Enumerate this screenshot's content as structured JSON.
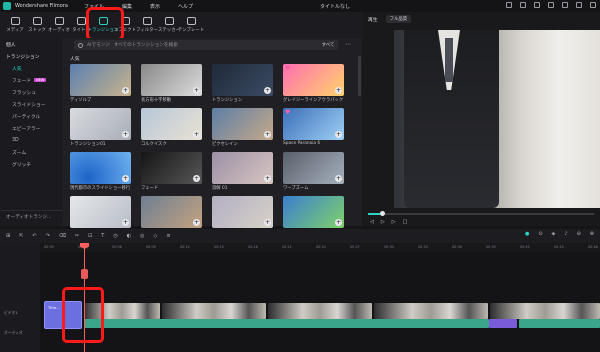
{
  "app": {
    "name": "Wondershare Filmora",
    "project_title": "タイトルなし"
  },
  "menu": [
    "ファイル",
    "編集",
    "表示",
    "ヘルプ"
  ],
  "toolbar": [
    {
      "label": "メディア",
      "icon": "media-icon"
    },
    {
      "label": "ストック",
      "icon": "stock-icon"
    },
    {
      "label": "オーディオ",
      "icon": "audio-icon"
    },
    {
      "label": "タイトル",
      "icon": "title-icon"
    },
    {
      "label": "トランジション",
      "icon": "transition-icon",
      "active": true
    },
    {
      "label": "エフェクト",
      "icon": "effect-icon"
    },
    {
      "label": "フィルター",
      "icon": "filter-icon"
    },
    {
      "label": "ステッカー",
      "icon": "sticker-icon"
    },
    {
      "label": "テンプレート",
      "icon": "template-icon"
    }
  ],
  "sidebar": {
    "items": [
      {
        "label": "個人",
        "type": "head"
      },
      {
        "label": "トランジション",
        "type": "head"
      },
      {
        "label": "人気",
        "type": "selected"
      },
      {
        "label": "フェード",
        "badge": "NEW"
      },
      {
        "label": "フラッシュ"
      },
      {
        "label": "スライドショー"
      },
      {
        "label": "パーティクル"
      },
      {
        "label": "エピーアラー"
      },
      {
        "label": "3D"
      },
      {
        "label": "ズーム"
      },
      {
        "label": "グリッチ"
      }
    ],
    "footer": "オーディオトランジ..."
  },
  "content": {
    "search_placeholder": "すべてのトランジションを検索",
    "search_prefix": "AIでモンジ",
    "filter": "すべて",
    "section": "人気",
    "items": [
      {
        "label": "ディゾルブ",
        "bg": "linear-gradient(135deg,#5b7fb0,#c9b48c)"
      },
      {
        "label": "長方形十字移動",
        "bg": "linear-gradient(135deg,#888,#ddd)"
      },
      {
        "label": "トランジション",
        "bg": "linear-gradient(135deg,#1f2a3a,#3b4b63)"
      },
      {
        "label": "グレイジーラインアウラパック トラン...",
        "bg": "linear-gradient(135deg,#ff6fb1,#ffd36b)",
        "heart": true
      },
      {
        "label": "トランジション01",
        "bg": "linear-gradient(135deg,#d8dbe0,#a9aeb6)"
      },
      {
        "label": "コルクイスク",
        "bg": "linear-gradient(135deg,#b7c6d8,#e9e2d3)"
      },
      {
        "label": "ピクセレイン",
        "bg": "linear-gradient(135deg,#5d7ea6,#c6a98a)"
      },
      {
        "label": "Space Paranoia 6",
        "bg": "linear-gradient(135deg,#3b6fb8,#9fd0f5)",
        "heart": true
      },
      {
        "label": "現代都市のスライドショー移行 02",
        "bg": "radial-gradient(circle at 30% 80%,#1e64c8,#6fb3f0)"
      },
      {
        "label": "フェード",
        "bg": "linear-gradient(135deg,#151515,#575757)"
      },
      {
        "label": "溶解 01",
        "bg": "linear-gradient(135deg,#9a90a6,#d9c6c1)"
      },
      {
        "label": "ワープズーム",
        "bg": "linear-gradient(135deg,#59606b,#a6b0bd)"
      },
      {
        "label": "",
        "bg": "linear-gradient(135deg,#e5e7ea,#b8bdc6)"
      },
      {
        "label": "",
        "bg": "linear-gradient(135deg,#6f7f93,#c3a27f)"
      },
      {
        "label": "",
        "bg": "linear-gradient(135deg,#b2afc4,#d8d1c8)"
      },
      {
        "label": "",
        "bg": "linear-gradient(135deg,#3a7fcf,#7fd16b)"
      }
    ]
  },
  "preview": {
    "mode": "再生",
    "quality": "フル品質"
  },
  "timeline": {
    "ticks": [
      "00:00",
      "00:03",
      "00:06",
      "00:09",
      "00:12",
      "00:15",
      "00:18",
      "00:21",
      "00:24",
      "00:27",
      "00:30",
      "00:33",
      "00:36",
      "00:39",
      "00:42",
      "00:45",
      "00:48"
    ],
    "track_video": "ビデオ1",
    "track_audio": "オーディオ",
    "clip_main": "Title..."
  }
}
